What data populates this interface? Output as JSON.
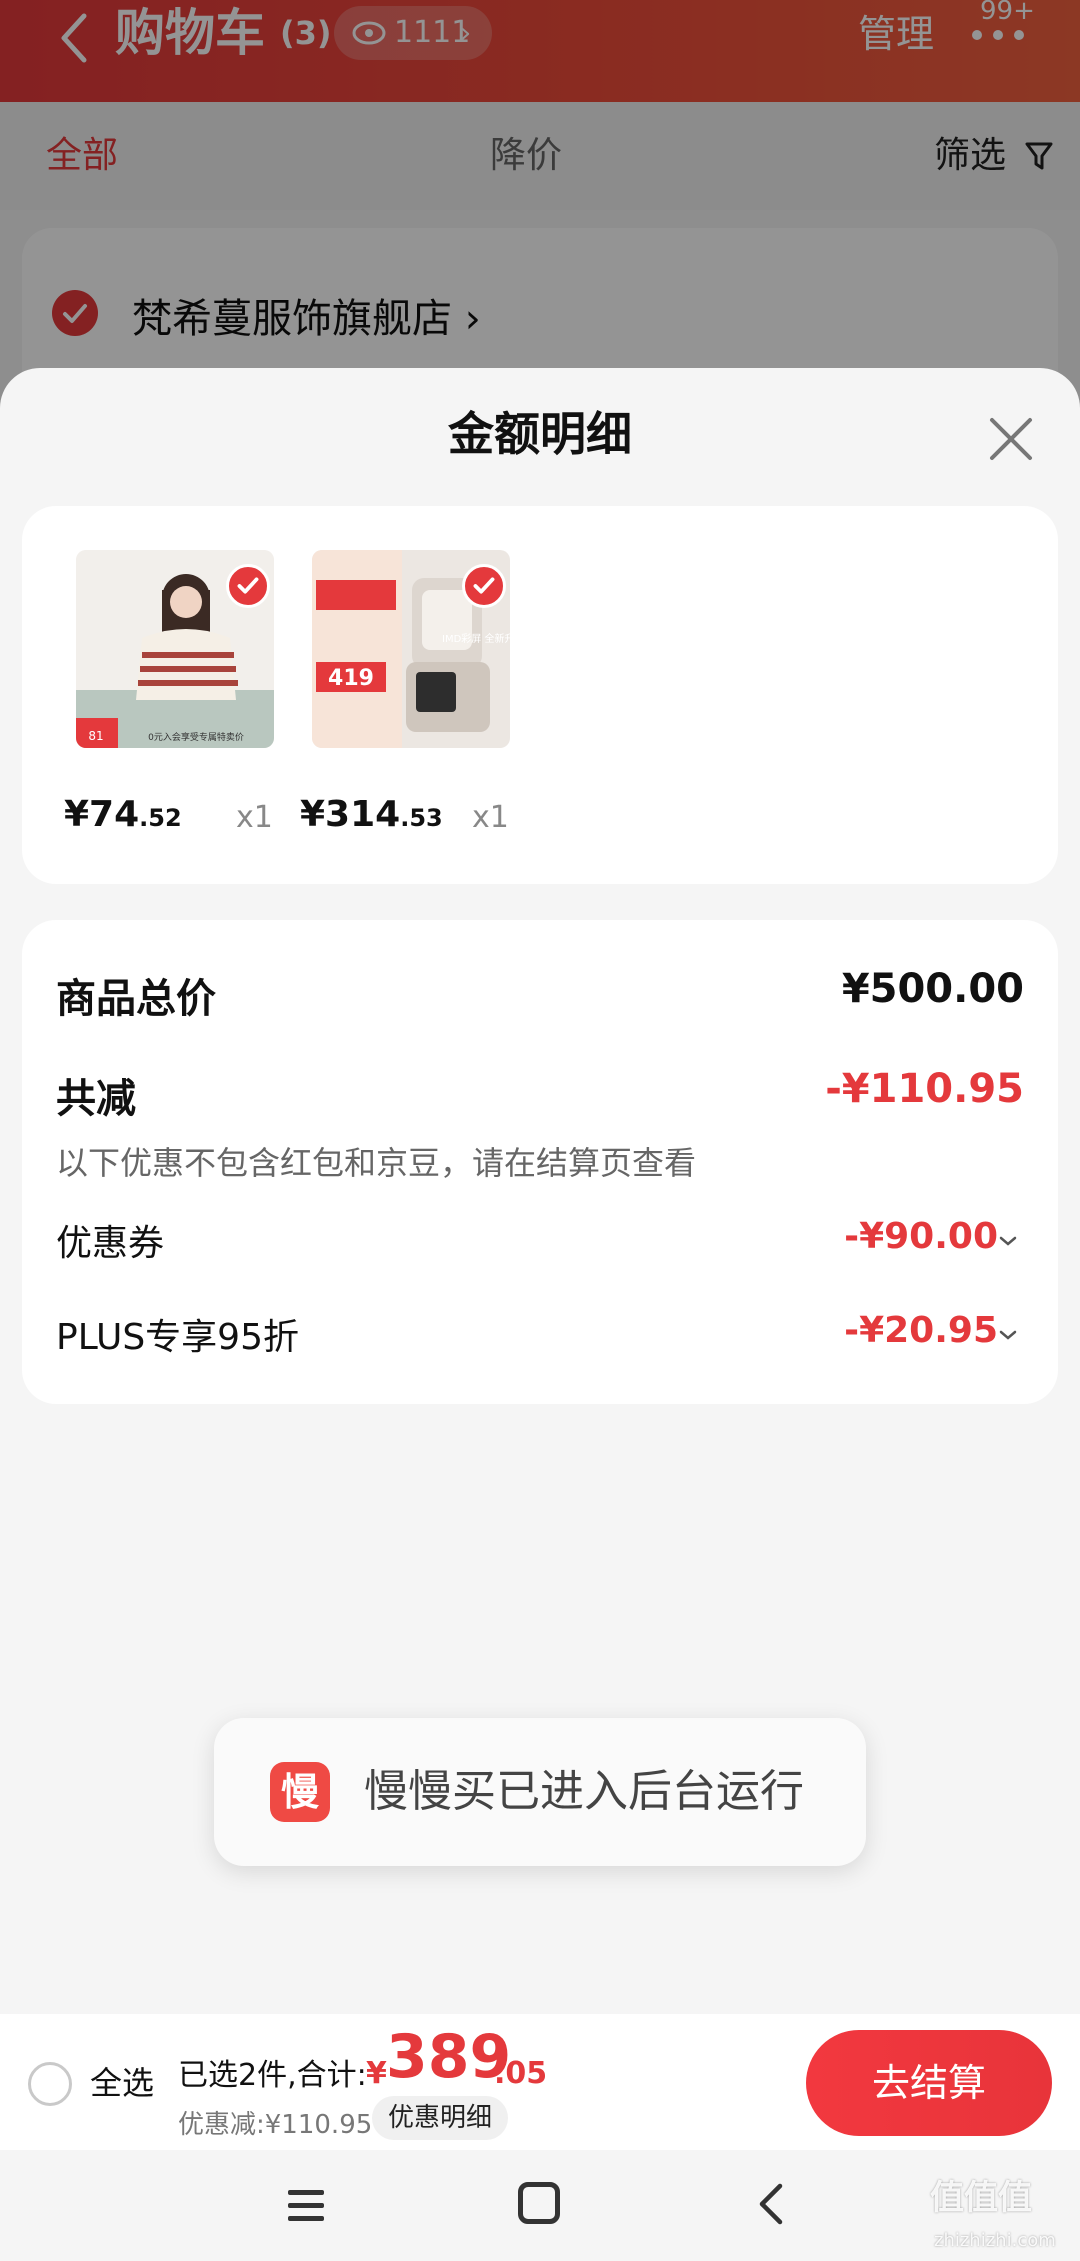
{
  "header": {
    "title": "购物车",
    "count": "(3)",
    "watch_count": "1111",
    "manage_label": "管理",
    "badge": "99+"
  },
  "filter_bar": {
    "tab_all": "全部",
    "tab_price_drop": "降价",
    "filter_label": "筛选"
  },
  "store": {
    "name": "梵希蔓服饰旗舰店",
    "chevron": "›"
  },
  "sheet": {
    "title": "金额明细",
    "products": [
      {
        "price_int": "¥74",
        "price_dec": ".52",
        "qty": "x1",
        "image_caption": "0元入会享受专属特卖价"
      },
      {
        "price_int": "¥314",
        "price_dec": ".53",
        "qty": "x1",
        "image_caption": "IMD彩屏 全新升级"
      }
    ],
    "summary": {
      "goods_total_label": "商品总价",
      "goods_total_value": "¥500.00",
      "total_reduce_label": "共减",
      "total_reduce_value": "-¥110.95",
      "note": "以下优惠不包含红包和京豆，请在结算页查看",
      "coupon_label": "优惠券",
      "coupon_value": "-¥90.00",
      "plus_label": "PLUS专享95折",
      "plus_value": "-¥20.95"
    }
  },
  "toast": {
    "icon_char": "慢",
    "text": "慢慢买已进入后台运行"
  },
  "bottom_bar": {
    "select_all_label": "全选",
    "selected_summary": "已选2件,合计:",
    "total_yen": "¥",
    "total_int": "389",
    "total_dec": ".05",
    "discount_text": "优惠减:¥110.95",
    "detail_label": "优惠明细",
    "checkout_label": "去结算"
  },
  "watermark": {
    "main": "值值值",
    "sub": "zhizhizhi.com"
  },
  "colors": {
    "accent_red": "#e4393c",
    "header_gradient_end": "#f2613f"
  },
  "icons": {
    "back": "chevron-left-icon",
    "eye": "eye-icon",
    "filter": "funnel-icon",
    "close": "close-icon",
    "check": "check-circle-icon"
  }
}
